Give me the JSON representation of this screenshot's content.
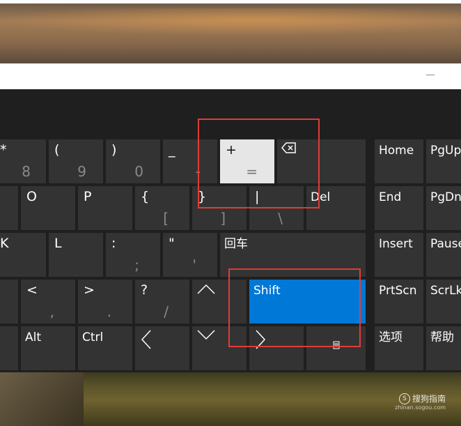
{
  "colors": {
    "key_bg": "#333333",
    "key_active": "#0078d7",
    "key_highlight": "#e6e6e6",
    "annotation": "#e23b35",
    "secondary_text": "#8a8a8a"
  },
  "keyboard": {
    "row1": [
      {
        "primary": "*",
        "secondary": "8"
      },
      {
        "primary": "(",
        "secondary": "9"
      },
      {
        "primary": ")",
        "secondary": "0"
      },
      {
        "primary": "_",
        "secondary": "-"
      },
      {
        "primary": "+",
        "secondary": "="
      },
      {
        "icon": "backspace-icon"
      }
    ],
    "row2": [
      {
        "primary": "O"
      },
      {
        "primary": "P"
      },
      {
        "primary": "{",
        "secondary": "["
      },
      {
        "primary": "}",
        "secondary": "]"
      },
      {
        "primary": "|",
        "secondary": "\\"
      },
      {
        "primary": "Del"
      }
    ],
    "row3": [
      {
        "primary": "K"
      },
      {
        "primary": "L"
      },
      {
        "primary": ":",
        "secondary": ";"
      },
      {
        "primary": "\"",
        "secondary": "'"
      },
      {
        "primary": "回车"
      }
    ],
    "row4": [
      {
        "primary": "<",
        "secondary": ","
      },
      {
        "primary": ">",
        "secondary": "."
      },
      {
        "primary": "?",
        "secondary": "/"
      },
      {
        "icon": "arrow-up-icon"
      },
      {
        "primary": "Shift"
      }
    ],
    "row5": [
      {
        "primary": "Alt"
      },
      {
        "primary": "Ctrl"
      },
      {
        "icon": "arrow-left-icon"
      },
      {
        "icon": "arrow-down-icon"
      },
      {
        "icon": "arrow-right-icon"
      },
      {
        "icon": "keyboard-settings-icon"
      }
    ],
    "nav": [
      {
        "label": "Home"
      },
      {
        "label": "PgUp"
      },
      {
        "label": "End"
      },
      {
        "label": "PgDn"
      },
      {
        "label": "Insert"
      },
      {
        "label": "Pause"
      },
      {
        "label": "PrtScn"
      },
      {
        "label": "ScrLk"
      },
      {
        "label": "选项"
      },
      {
        "label": "帮助"
      }
    ]
  },
  "watermark": {
    "brand": "搜狗指南",
    "url": "zhinan.sogou.com"
  }
}
